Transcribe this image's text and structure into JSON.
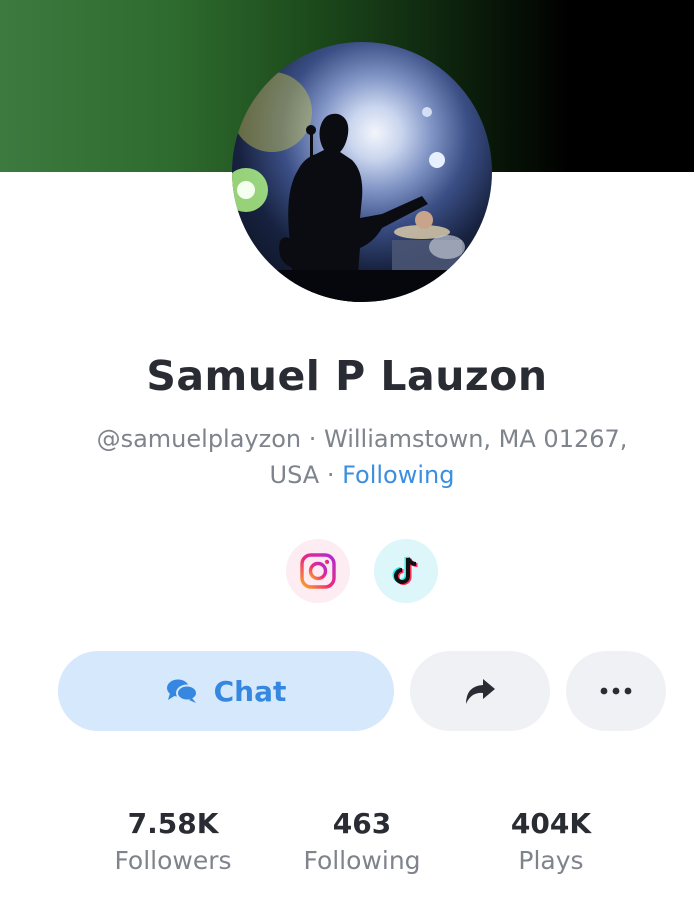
{
  "profile": {
    "name": "Samuel P Lauzon",
    "handle": "@samuelplayzon",
    "separator1": " · ",
    "location_line1": "Williamstown, MA 01267,",
    "location_line2": "USA",
    "separator2": " · ",
    "follow_status": "Following"
  },
  "social": {
    "instagram_icon": "instagram-icon",
    "tiktok_icon": "tiktok-icon"
  },
  "actions": {
    "chat_label": "Chat",
    "chat_icon": "chat-bubbles-icon",
    "share_icon": "share-arrow-icon",
    "more_icon": "ellipsis-icon"
  },
  "stats": [
    {
      "value": "7.58K",
      "label": "Followers"
    },
    {
      "value": "463",
      "label": "Following"
    },
    {
      "value": "404K",
      "label": "Plays"
    }
  ],
  "colors": {
    "accent": "#3c8fe0",
    "chat_bg": "#d6e8fc",
    "button_bg": "#eff1f4",
    "text_dark": "#2a2c33",
    "text_muted": "#7e838c"
  }
}
